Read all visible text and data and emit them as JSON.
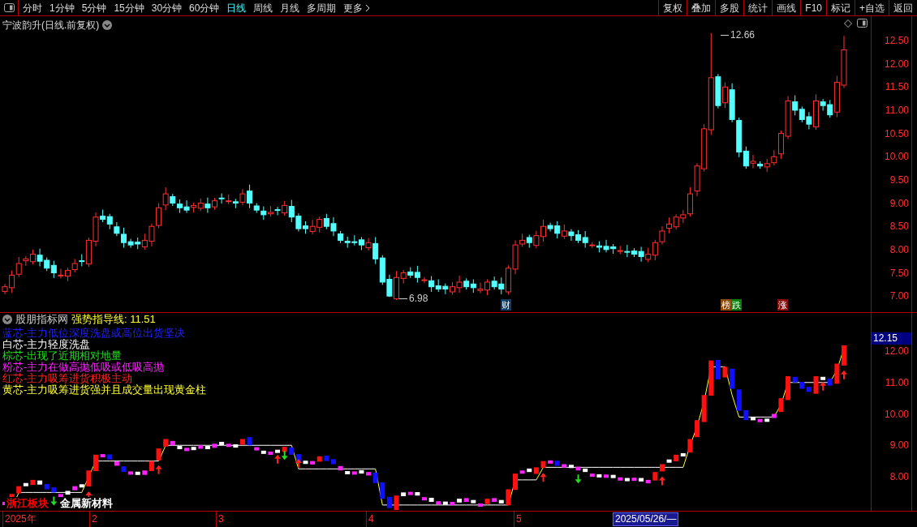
{
  "toolbar": {
    "periods": [
      {
        "label": "分时",
        "selected": false
      },
      {
        "label": "1分钟",
        "selected": false
      },
      {
        "label": "5分钟",
        "selected": false
      },
      {
        "label": "15分钟",
        "selected": false
      },
      {
        "label": "30分钟",
        "selected": false
      },
      {
        "label": "60分钟",
        "selected": false
      },
      {
        "label": "日线",
        "selected": true
      },
      {
        "label": "周线",
        "selected": false
      },
      {
        "label": "月线",
        "selected": false
      },
      {
        "label": "多周期",
        "selected": false
      }
    ],
    "more": "更多",
    "actions": [
      "复权",
      "叠加",
      "多股",
      "统计",
      "画线",
      "F10",
      "标记",
      "+自选",
      "返回"
    ]
  },
  "main_chart": {
    "title": "宁波韵升(日线.前复权)",
    "y_labels": [
      "12.50",
      "12.00",
      "11.50",
      "11.00",
      "10.50",
      "10.00",
      "9.50",
      "9.00",
      "8.50",
      "8.00",
      "7.50",
      "7.00"
    ],
    "high_label": "12.66",
    "low_label": "6.98",
    "markers": [
      {
        "text": "财",
        "color": "#0e3a66"
      },
      {
        "text": "榜",
        "color": "#8a4a0c"
      },
      {
        "text": "跌",
        "color": "#0a7a0a"
      },
      {
        "text": "涨",
        "color": "#8a0a0a"
      }
    ]
  },
  "indicator": {
    "source": "股朋指标网",
    "line_label": "强势指导线: 11.51",
    "current_value": "12.15",
    "y_labels": [
      "12.00",
      "11.00",
      "10.00",
      "9.00",
      "8.00"
    ],
    "legend": [
      {
        "text": "蓝芯-主力低位深度洗盘或高位出货坚决",
        "color": "#2020ff"
      },
      {
        "text": "白芯-主力轻度洗盘",
        "color": "#ffffff"
      },
      {
        "text": "棕芯-出现了近期相对地量",
        "color": "#22dd22"
      },
      {
        "text": "粉芯-主力在做高抛低吸或低吸高抛",
        "color": "#ff22ff"
      },
      {
        "text": "红芯-主力吸筹进货积极主动",
        "color": "#ff2020"
      },
      {
        "text": "黄芯-主力吸筹进货强并且成交量出现黄金柱",
        "color": "#ffff33"
      }
    ],
    "sector_tags": [
      {
        "text": "浙江板块",
        "color": "#ff0000"
      },
      {
        "text": "金属新材料",
        "color": "#ffffff"
      }
    ]
  },
  "date_axis": {
    "labels": [
      "2025年",
      "2",
      "3",
      "4",
      "5"
    ],
    "cursor_date": "2025/05/26/—"
  }
}
